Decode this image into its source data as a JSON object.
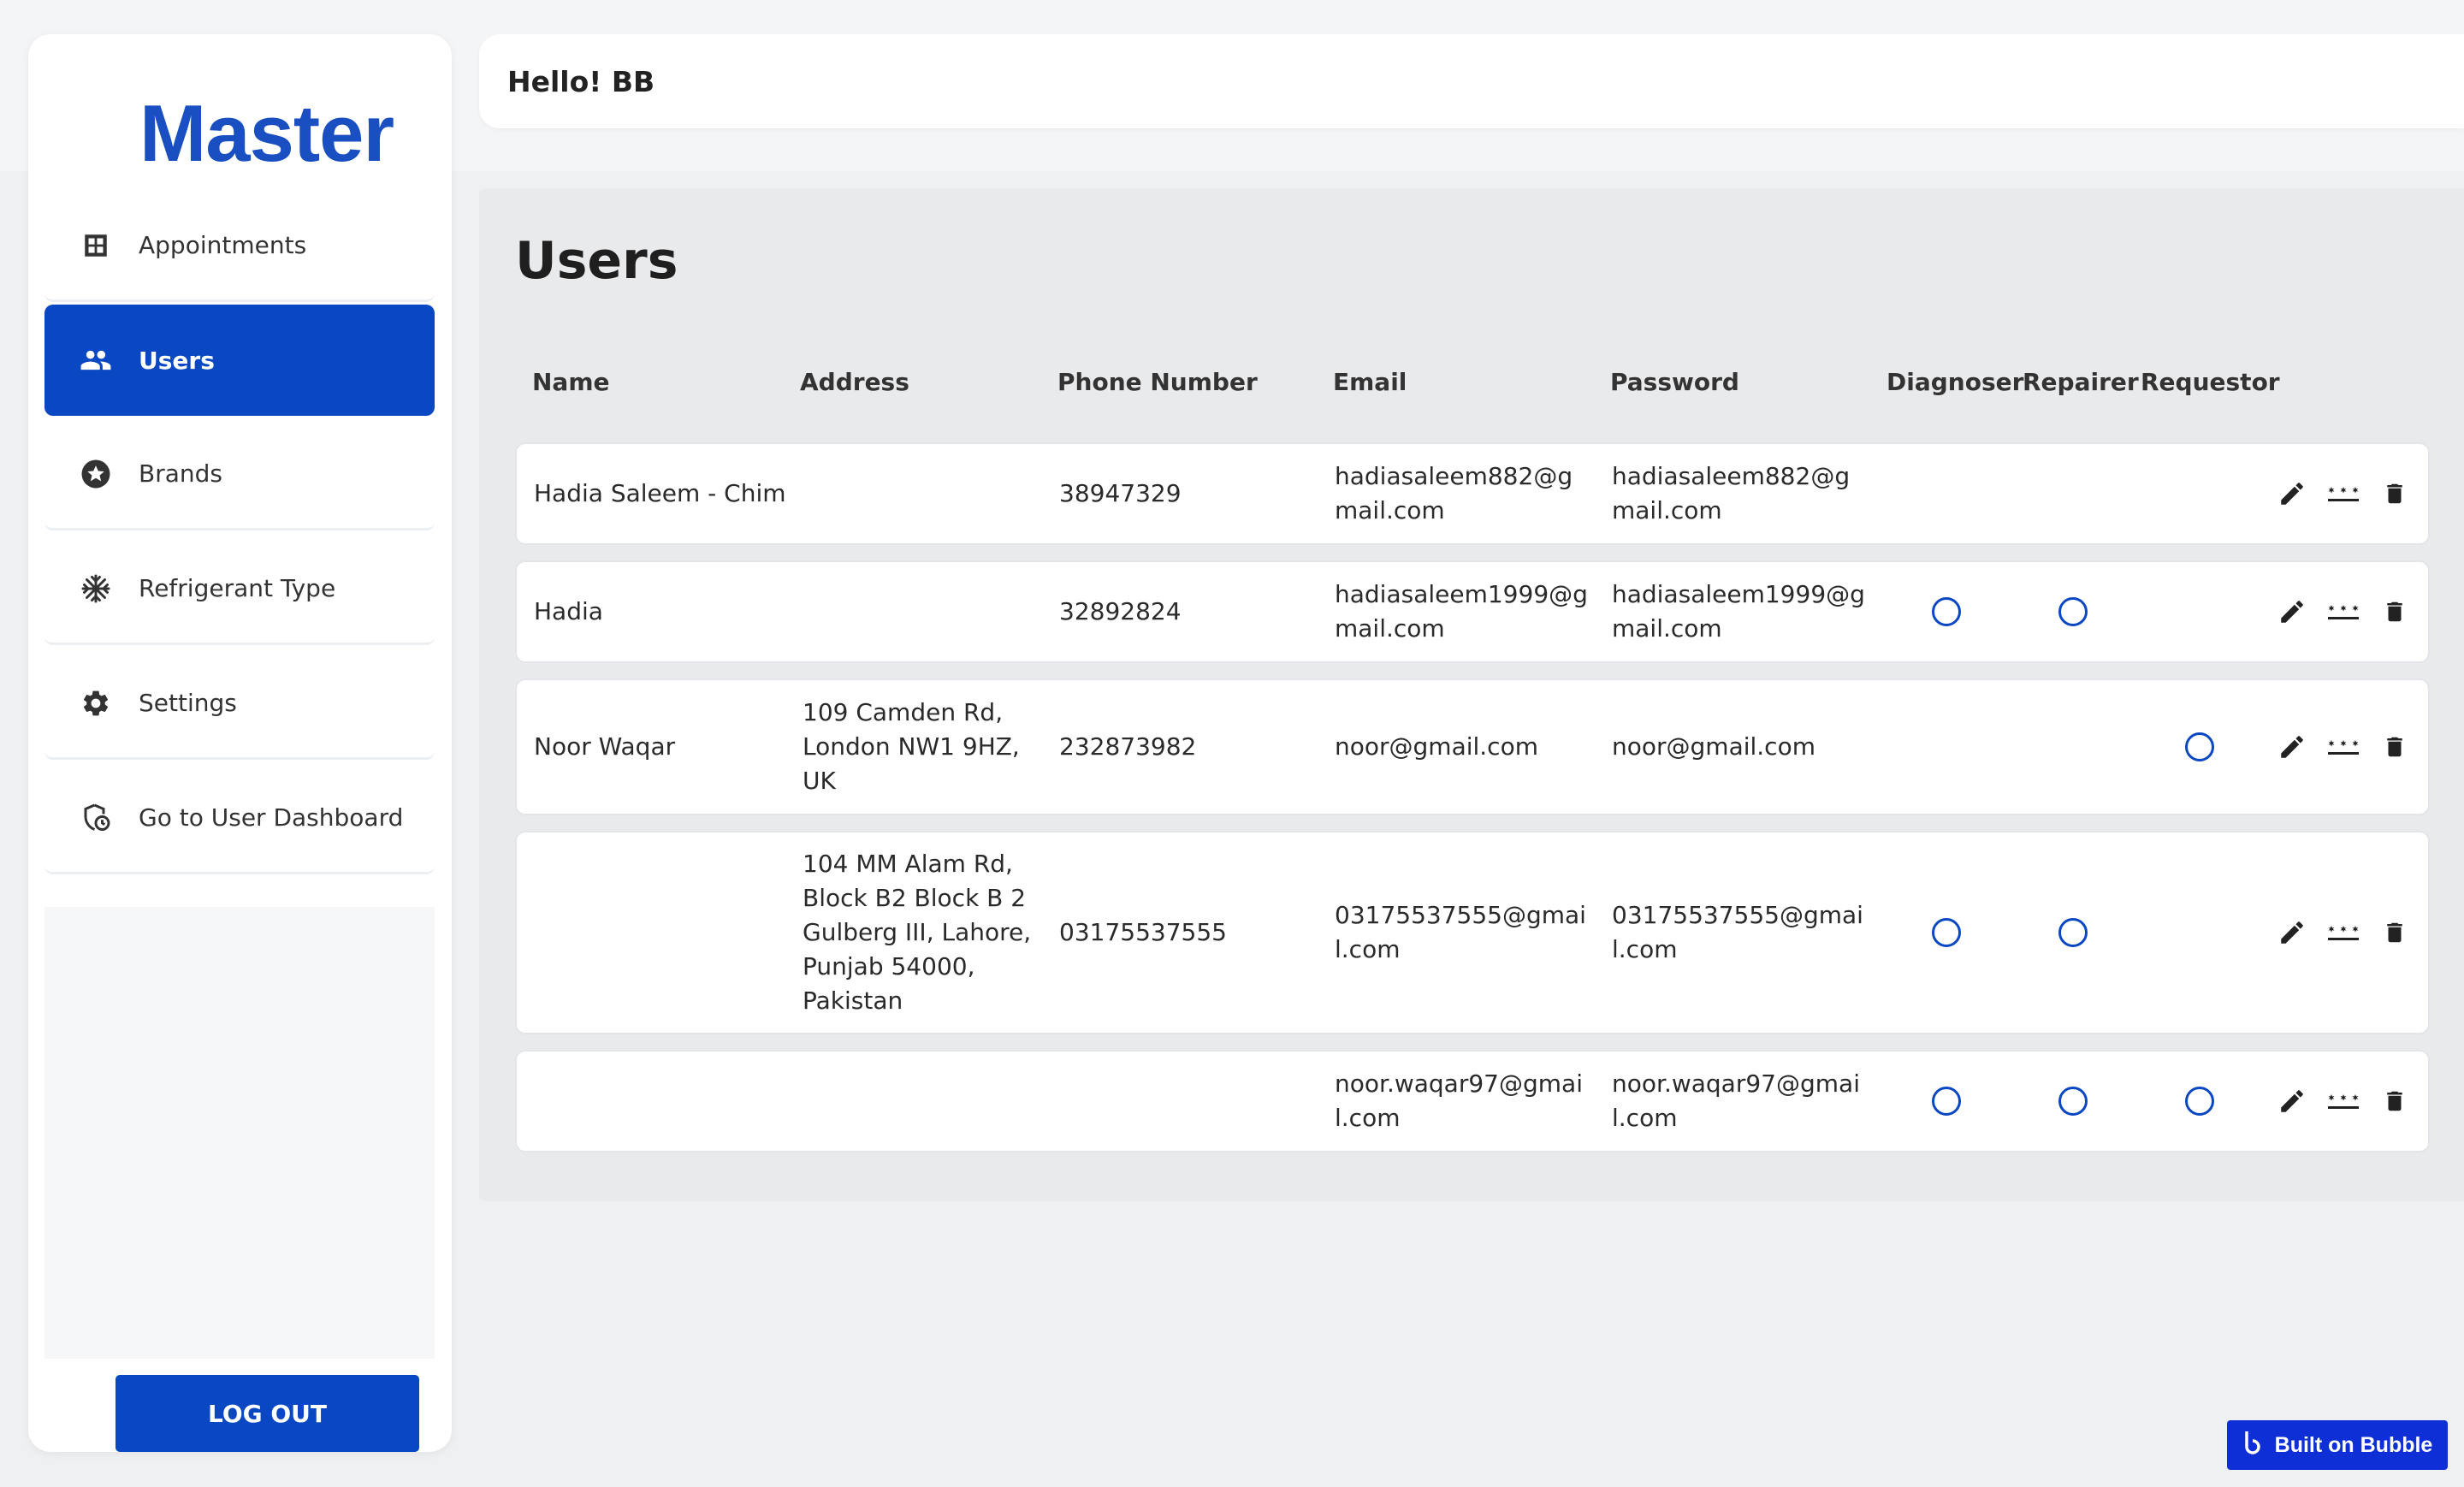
{
  "app": {
    "logo_text": "Master"
  },
  "sidebar": {
    "items": [
      {
        "label": "Appointments",
        "icon": "grid-icon"
      },
      {
        "label": "Users",
        "icon": "users-icon",
        "active": true
      },
      {
        "label": "Brands",
        "icon": "star-badge-icon"
      },
      {
        "label": "Refrigerant Type",
        "icon": "snowflake-icon"
      },
      {
        "label": "Settings",
        "icon": "gear-icon"
      },
      {
        "label": "Go to User Dashboard",
        "icon": "shield-clock-icon"
      }
    ],
    "logout_label": "LOG OUT"
  },
  "header": {
    "greeting": "Hello! BB"
  },
  "main": {
    "title": "Users",
    "columns": [
      "Name",
      "Address",
      "Phone Number",
      "Email",
      "Password",
      "Diagnoser",
      "Repairer",
      "Requestor"
    ],
    "rows": [
      {
        "name": "Hadia Saleem - Chim",
        "address": "",
        "phone": "38947329",
        "email": "hadiasaleem882@gmail.com",
        "password": "hadiasaleem882@gmail.com",
        "diagnoser": true,
        "repairer": true,
        "requestor": true
      },
      {
        "name": "Hadia",
        "address": "",
        "phone": "32892824",
        "email": "hadiasaleem1999@gmail.com",
        "password": "hadiasaleem1999@gmail.com",
        "diagnoser": false,
        "repairer": false,
        "requestor": true
      },
      {
        "name": "Noor Waqar",
        "address": "109 Camden Rd, London NW1 9HZ, UK",
        "phone": "232873982",
        "email": "noor@gmail.com",
        "password": "noor@gmail.com",
        "diagnoser": true,
        "repairer": true,
        "requestor": false
      },
      {
        "name": "",
        "address": "104 MM Alam Rd, Block B2 Block B 2 Gulberg III, Lahore, Punjab 54000, Pakistan",
        "phone": "03175537555",
        "email": "03175537555@gmail.com",
        "password": "03175537555@gmail.com",
        "diagnoser": false,
        "repairer": false,
        "requestor": true
      },
      {
        "name": "",
        "address": "",
        "phone": "",
        "email": "noor.waqar97@gmail.com",
        "password": "noor.waqar97@gmail.com",
        "diagnoser": false,
        "repairer": false,
        "requestor": false
      }
    ],
    "row_actions": [
      "pencil-icon",
      "password-dots-icon",
      "trash-icon"
    ]
  },
  "badge": {
    "label": "Built on Bubble"
  },
  "colors": {
    "accent": "#0a47c2",
    "background": "#eff0f2",
    "panel": "#e9eaec"
  }
}
